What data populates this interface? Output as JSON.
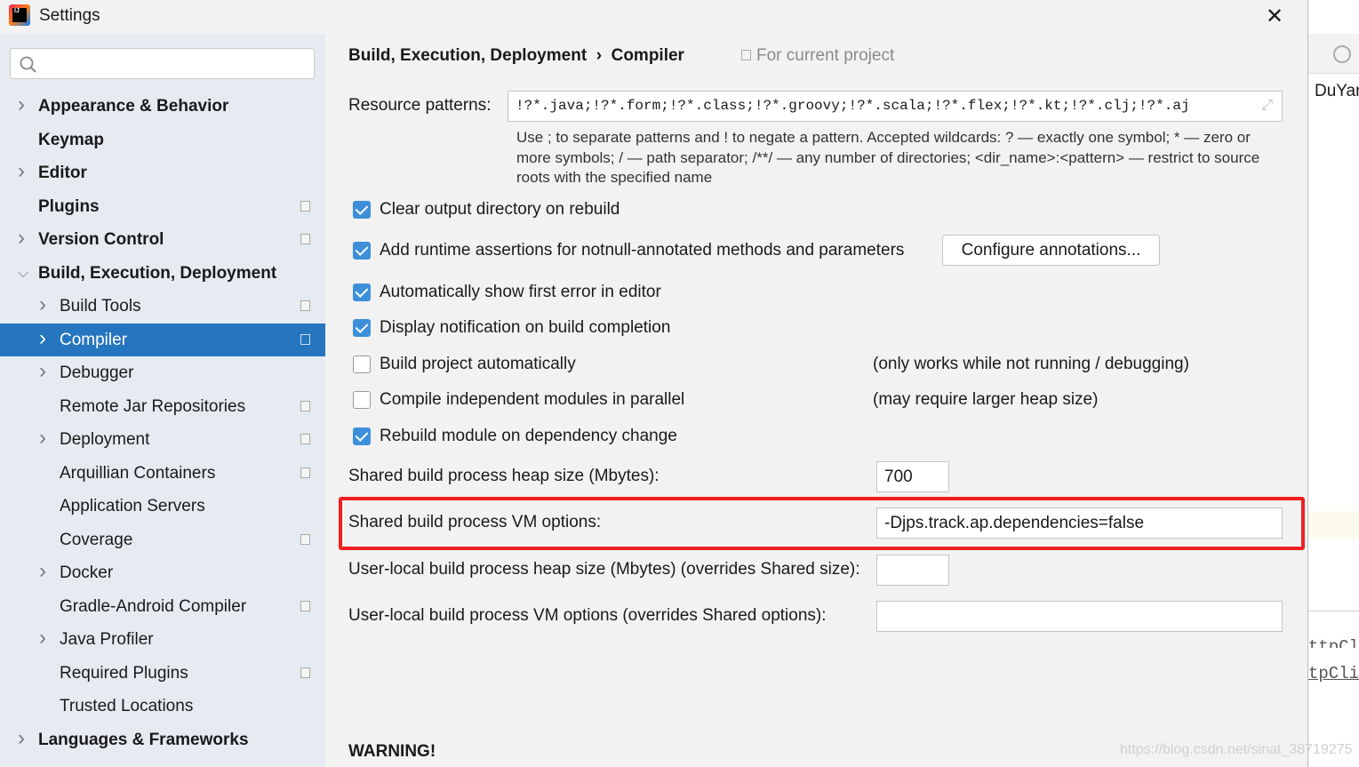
{
  "window": {
    "title": "Settings",
    "close": "✕"
  },
  "sidebar": {
    "search_placeholder": "",
    "items": [
      {
        "label": "Appearance & Behavior",
        "bold": true,
        "chevron": true,
        "level": 0
      },
      {
        "label": "Keymap",
        "bold": true,
        "chevron": false,
        "level": 0
      },
      {
        "label": "Editor",
        "bold": true,
        "chevron": true,
        "level": 0
      },
      {
        "label": "Plugins",
        "bold": true,
        "chevron": false,
        "level": 0,
        "project": true
      },
      {
        "label": "Version Control",
        "bold": true,
        "chevron": true,
        "level": 0,
        "project": true
      },
      {
        "label": "Build, Execution, Deployment",
        "bold": true,
        "chevron": "open",
        "level": 0
      },
      {
        "label": "Build Tools",
        "chevron": true,
        "level": 1,
        "project": true
      },
      {
        "label": "Compiler",
        "chevron": true,
        "level": 1,
        "project": true,
        "selected": true
      },
      {
        "label": "Debugger",
        "chevron": true,
        "level": 1
      },
      {
        "label": "Remote Jar Repositories",
        "level": 1,
        "project": true
      },
      {
        "label": "Deployment",
        "chevron": true,
        "level": 1,
        "project": true
      },
      {
        "label": "Arquillian Containers",
        "level": 1,
        "project": true
      },
      {
        "label": "Application Servers",
        "level": 1
      },
      {
        "label": "Coverage",
        "level": 1,
        "project": true
      },
      {
        "label": "Docker",
        "chevron": true,
        "level": 1
      },
      {
        "label": "Gradle-Android Compiler",
        "level": 1,
        "project": true
      },
      {
        "label": "Java Profiler",
        "chevron": true,
        "level": 1
      },
      {
        "label": "Required Plugins",
        "level": 1,
        "project": true
      },
      {
        "label": "Trusted Locations",
        "level": 1
      },
      {
        "label": "Languages & Frameworks",
        "bold": true,
        "chevron": true,
        "level": 0
      }
    ]
  },
  "main": {
    "breadcrumb": [
      "Build, Execution, Deployment",
      "Compiler"
    ],
    "breadcrumb_sep": "›",
    "for_project": "For current project",
    "resource_label": "Resource patterns:",
    "resource_value": "!?*.java;!?*.form;!?*.class;!?*.groovy;!?*.scala;!?*.flex;!?*.kt;!?*.clj;!?*.aj",
    "help": "Use ; to separate patterns and ! to negate a pattern. Accepted wildcards: ? — exactly one symbol; * — zero or more symbols; / — path separator; /**/ — any number of directories; <dir_name>:<pattern> — restrict to source roots with the specified name",
    "checkboxes": [
      {
        "label": "Clear output directory on rebuild",
        "checked": true
      },
      {
        "label": "Add runtime assertions for notnull-annotated methods and parameters",
        "checked": true
      },
      {
        "label": "Automatically show first error in editor",
        "checked": true
      },
      {
        "label": "Display notification on build completion",
        "checked": true
      },
      {
        "label": "Build project automatically",
        "checked": false,
        "note": "(only works while not running / debugging)"
      },
      {
        "label": "Compile independent modules in parallel",
        "checked": false,
        "note": "(may require larger heap size)"
      },
      {
        "label": "Rebuild module on dependency change",
        "checked": true
      }
    ],
    "configure_button": "Configure annotations...",
    "heap_label": "Shared build process heap size (Mbytes):",
    "heap_value": "700",
    "vm_label": "Shared build process VM options:",
    "vm_value": "-Djps.track.ap.dependencies=false",
    "user_heap_label": "User-local build process heap size (Mbytes) (overrides Shared size):",
    "user_heap_value": "",
    "user_vm_label": "User-local build process VM options (overrides Shared options):",
    "user_vm_value": "",
    "warning": "WARNING!"
  },
  "background": {
    "tab": "DuYar",
    "code1": "ttpCl",
    "code2": "tpCli"
  },
  "watermark": "https://blog.csdn.net/sinat_38719275",
  "colors": {
    "selection": "#2675bf",
    "checkbox": "#3d8fd9",
    "highlight": "#f02020"
  }
}
